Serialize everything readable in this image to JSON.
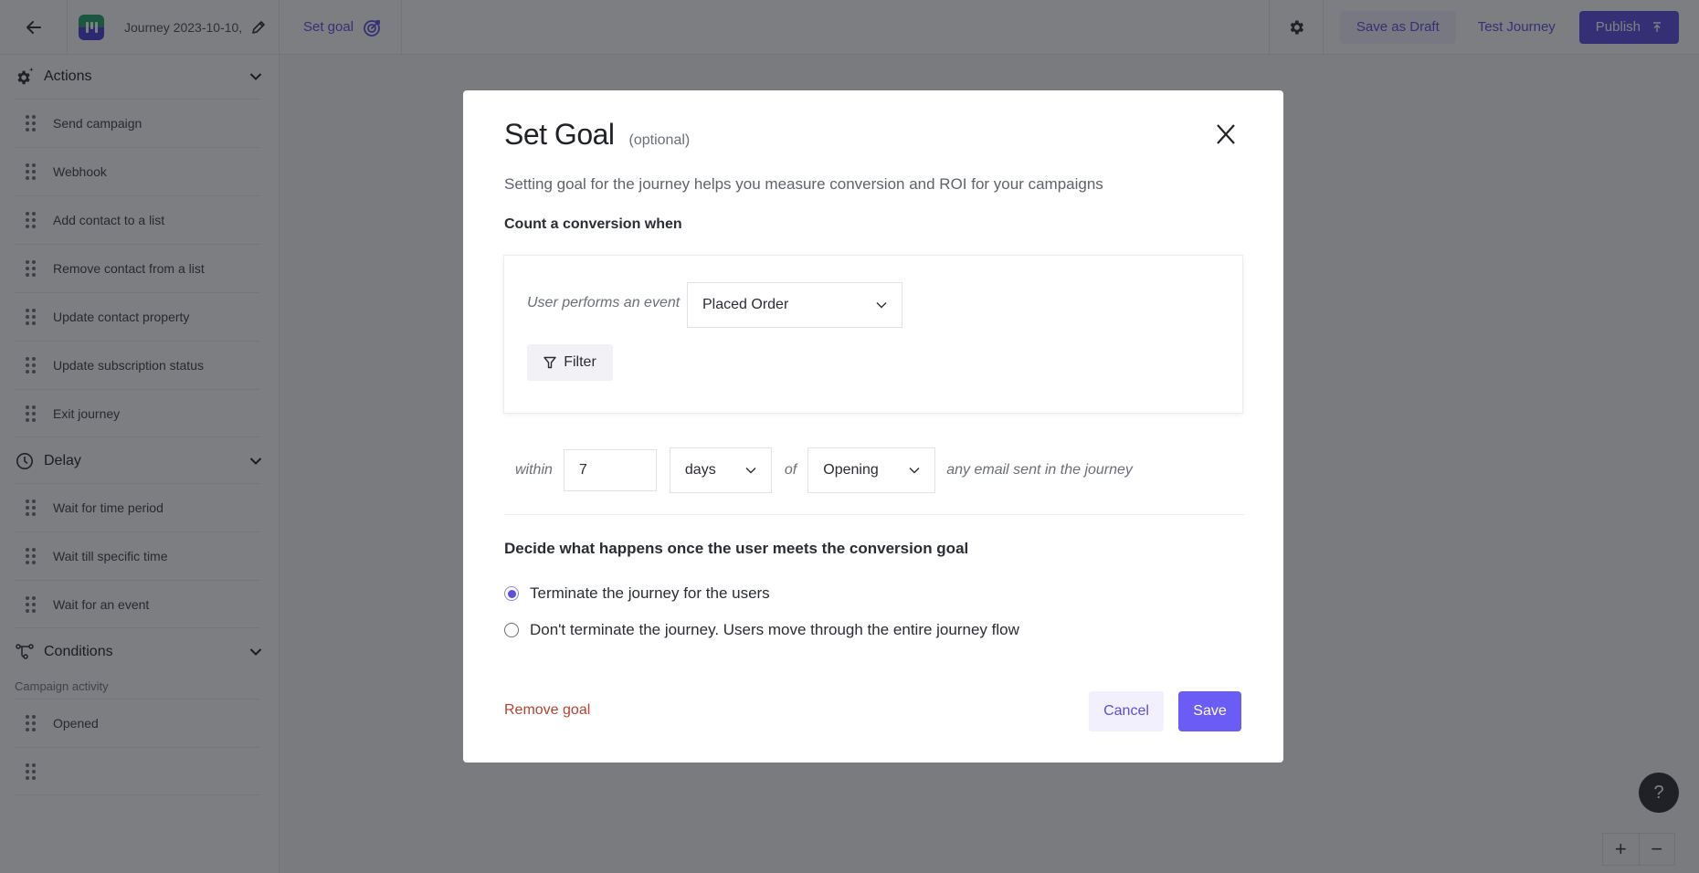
{
  "topbar": {
    "back_icon": "arrow-left-icon",
    "journey_name": "Journey 2023-10-10,",
    "edit_icon": "pencil-icon",
    "set_goal_label": "Set goal",
    "set_goal_icon": "target-icon",
    "settings_icon": "gear-icon",
    "save_draft_label": "Save as Draft",
    "test_journey_label": "Test Journey",
    "publish_label": "Publish",
    "publish_icon": "arrow-up-to-line-icon"
  },
  "sidebar": {
    "sections": [
      {
        "label": "Actions",
        "icon": "gear-sparkle-icon",
        "items": [
          "Send campaign",
          "Webhook",
          "Add contact to a list",
          "Remove contact from a list",
          "Update contact property",
          "Update subscription status",
          "Exit journey"
        ]
      },
      {
        "label": "Delay",
        "icon": "clock-icon",
        "items": [
          "Wait for time period",
          "Wait till specific time",
          "Wait for an event"
        ]
      },
      {
        "label": "Conditions",
        "icon": "branch-icon",
        "subheading": "Campaign activity",
        "items": [
          "Opened"
        ]
      }
    ]
  },
  "canvas": {
    "help_label": "?",
    "zoom_in_label": "+",
    "zoom_out_label": "−"
  },
  "modal": {
    "title": "Set Goal",
    "optional": "(optional)",
    "close_icon": "close-x-icon",
    "description": "Setting goal for the journey helps you measure conversion and ROI for your campaigns",
    "count_title": "Count a conversion when",
    "event_label": "User performs an event",
    "event_value": "Placed Order",
    "filter_label": "Filter",
    "within_label": "within",
    "within_value": "7",
    "unit_value": "days",
    "of_label": "of",
    "activity_value": "Opening",
    "tail_label": "any email sent in the journey",
    "decide_title": "Decide what happens once the user meets the conversion goal",
    "options": [
      {
        "label": "Terminate the journey for the users",
        "selected": true
      },
      {
        "label": "Don't terminate the journey. Users move through the entire journey flow",
        "selected": false
      }
    ],
    "remove_label": "Remove goal",
    "cancel_label": "Cancel",
    "save_label": "Save"
  },
  "colors": {
    "accent": "#5b4fe0",
    "save_button": "#6b5cf6",
    "danger_link": "#b5432f"
  }
}
